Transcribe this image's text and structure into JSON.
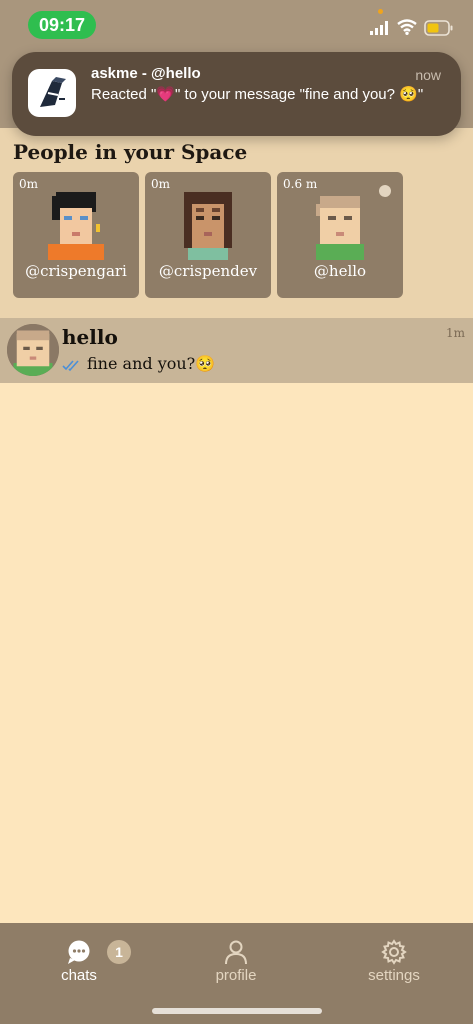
{
  "status_bar": {
    "time": "09:17"
  },
  "notification": {
    "app_title": "askme - @hello",
    "time": "now",
    "body": "Reacted \"💗\" to your message \"fine and you? 🥺\""
  },
  "space": {
    "title": "People in your Space",
    "people": [
      {
        "distance": "0m",
        "handle": "@crispengari",
        "avatar": "avatar-black-hair-orange-shirt",
        "online": false
      },
      {
        "distance": "0m",
        "handle": "@crispendev",
        "avatar": "avatar-long-brown-hair",
        "online": false
      },
      {
        "distance": "0.6 m",
        "handle": "@hello",
        "avatar": "avatar-light-hair-green-shirt",
        "online": true
      }
    ]
  },
  "chats": [
    {
      "name": "hello",
      "time": "1m",
      "preview": "fine and you?🥺",
      "read_icon": "double-check-icon"
    }
  ],
  "bottom_nav": {
    "items": [
      {
        "label": "chats",
        "icon": "chat-bubble-icon",
        "active": true,
        "badge": "1"
      },
      {
        "label": "profile",
        "icon": "person-icon",
        "active": false
      },
      {
        "label": "settings",
        "icon": "gear-icon",
        "active": false
      }
    ]
  },
  "colors": {
    "background": "#fde6bd",
    "nav_bg": "#8f7d67",
    "card_bg": "#8f7d67",
    "chat_row_bg": "#c8b598",
    "status_pill": "#2fbe4f"
  }
}
